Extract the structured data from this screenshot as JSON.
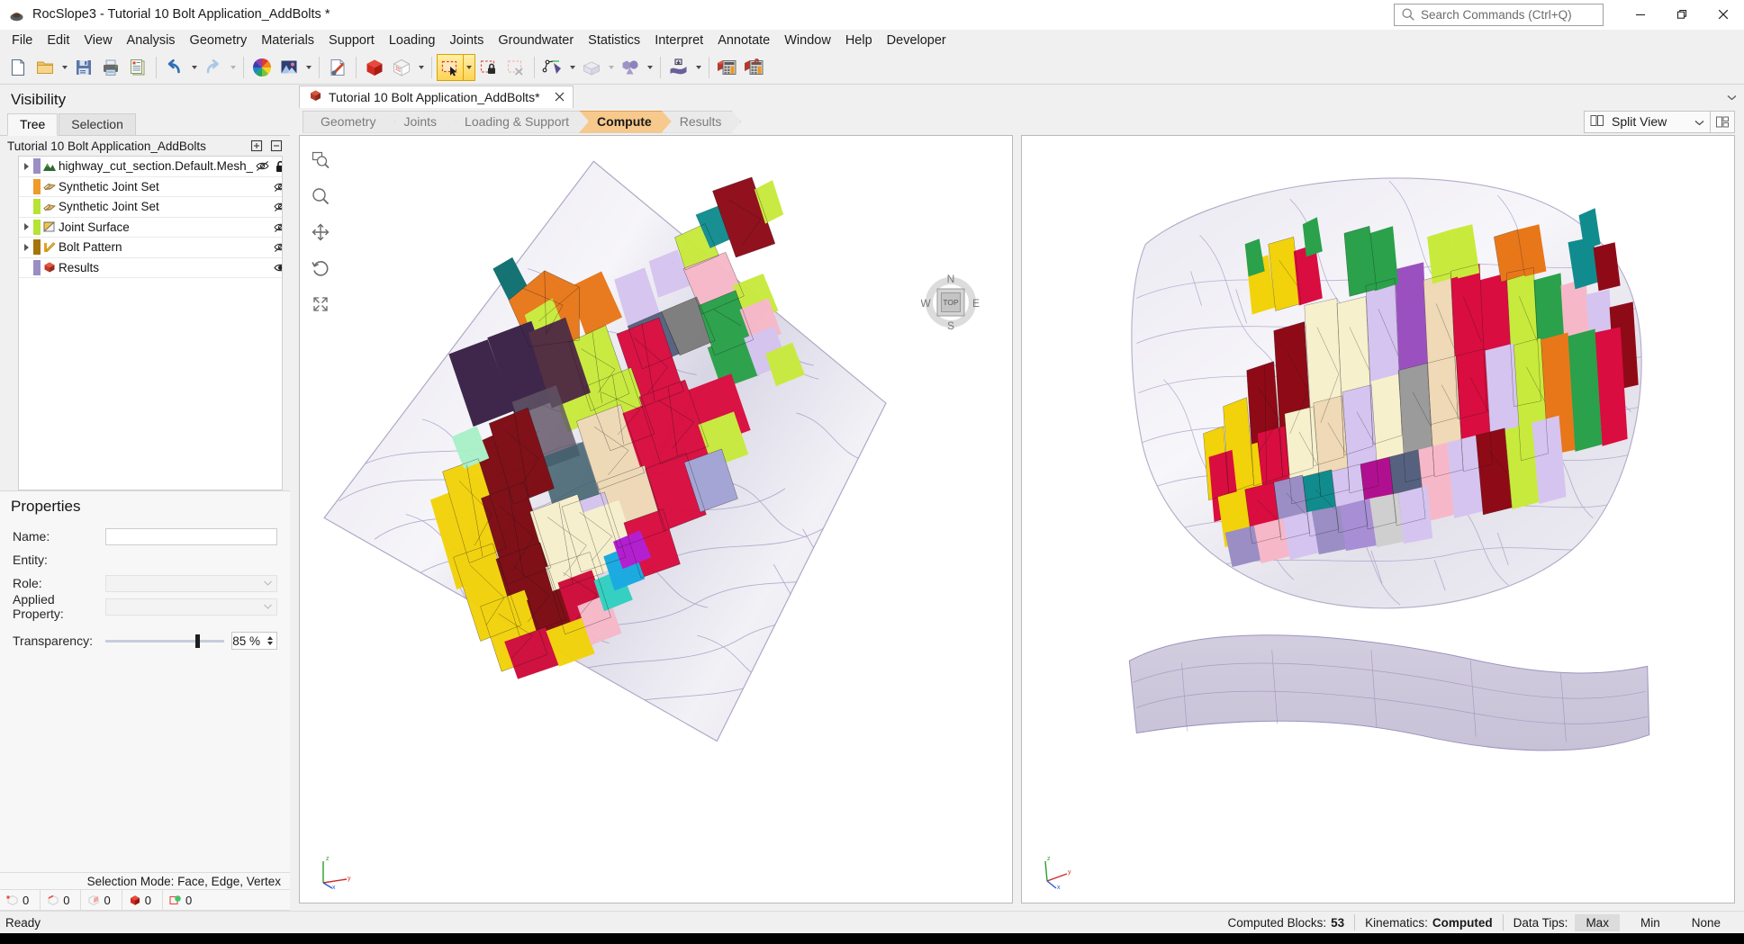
{
  "window": {
    "title": "RocSlope3 - Tutorial 10 Bolt Application_AddBolts *",
    "app_icon": "rocslope-icon",
    "minimize_label": "Minimize",
    "restore_label": "Restore",
    "close_label": "Close"
  },
  "search": {
    "placeholder": "Search Commands (Ctrl+Q)",
    "icon": "search-icon"
  },
  "menu": {
    "items": [
      "File",
      "Edit",
      "View",
      "Analysis",
      "Geometry",
      "Materials",
      "Support",
      "Loading",
      "Joints",
      "Groundwater",
      "Statistics",
      "Interpret",
      "Annotate",
      "Window",
      "Help",
      "Developer"
    ]
  },
  "toolbar": {
    "groups": [
      {
        "buttons": [
          {
            "name": "new-file-icon",
            "tip": "New"
          },
          {
            "name": "open-folder-icon",
            "tip": "Open",
            "dropdown": true
          },
          {
            "name": "save-icon",
            "tip": "Save"
          },
          {
            "name": "print-icon",
            "tip": "Print"
          },
          {
            "name": "report-icon",
            "tip": "Report"
          }
        ]
      },
      {
        "buttons": [
          {
            "name": "undo-icon",
            "tip": "Undo",
            "dropdown": true
          },
          {
            "name": "redo-icon",
            "tip": "Redo",
            "dropdown": true,
            "disabled": true
          }
        ]
      },
      {
        "buttons": [
          {
            "name": "color-wheel-icon",
            "tip": "Display Options"
          },
          {
            "name": "image-icon",
            "tip": "Image",
            "dropdown": true
          }
        ]
      },
      {
        "buttons": [
          {
            "name": "project-settings-icon",
            "tip": "Project Settings"
          }
        ]
      },
      {
        "buttons": [
          {
            "name": "solid-cube-icon",
            "tip": "Show Solids"
          },
          {
            "name": "wireframe-cube-icon",
            "tip": "Show Mesh",
            "dropdown": true
          }
        ]
      },
      {
        "buttons": [
          {
            "name": "select-rectangle-icon",
            "tip": "Select",
            "active": true,
            "dropdown": true
          },
          {
            "name": "lock-selection-icon",
            "tip": "Lock Selection"
          },
          {
            "name": "clear-selection-icon",
            "tip": "Clear Selection",
            "disabled": true
          }
        ]
      },
      {
        "buttons": [
          {
            "name": "polyline-pen-icon",
            "tip": "Add Polyline",
            "dropdown": true
          },
          {
            "name": "box-geometry-icon",
            "tip": "Add Box",
            "dropdown": true
          },
          {
            "name": "boolean-shapes-icon",
            "tip": "Boolean",
            "dropdown": true
          }
        ]
      },
      {
        "buttons": [
          {
            "name": "surface-icon",
            "tip": "Import Surface",
            "dropdown": true
          }
        ]
      },
      {
        "buttons": [
          {
            "name": "compute-icon",
            "tip": "Compute"
          },
          {
            "name": "interpret-icon",
            "tip": "Interpret"
          }
        ]
      }
    ]
  },
  "visibility": {
    "title": "Visibility",
    "tabs": [
      {
        "label": "Tree",
        "selected": true
      },
      {
        "label": "Selection",
        "selected": false
      }
    ],
    "root_label": "Tutorial 10 Bolt Application_AddBolts",
    "expand_all_icon": "expand-all-icon",
    "collapse_all_icon": "collapse-all-icon",
    "tree": [
      {
        "label": "highway_cut_section.Default.Mesh_",
        "icon": "terrain-mesh-icon",
        "swatch": "#9b8ec4",
        "expandable": true,
        "visible": false,
        "locked": true,
        "visibility_icon": "eye-hidden-icon",
        "lock_icon": "lock-icon",
        "delete_icon": "trash-icon"
      },
      {
        "label": "Synthetic Joint Set",
        "icon": "joint-set-icon",
        "swatch": "#f09a28",
        "expandable": false,
        "visible": false,
        "locked": false,
        "visibility_icon": "eye-hidden-icon",
        "delete_icon": "trash-icon"
      },
      {
        "label": "Synthetic Joint Set",
        "icon": "joint-set-icon",
        "swatch": "#b6e335",
        "expandable": false,
        "visible": false,
        "locked": false,
        "visibility_icon": "eye-hidden-icon",
        "delete_icon": "trash-icon"
      },
      {
        "label": "Joint Surface",
        "icon": "joint-surface-icon",
        "swatch": "#b6e335",
        "expandable": true,
        "visible": false,
        "locked": false,
        "visibility_icon": "eye-hidden-icon",
        "delete_icon": "trash-icon"
      },
      {
        "label": "Bolt Pattern",
        "icon": "bolt-pattern-icon",
        "swatch": "#a5750a",
        "expandable": true,
        "visible": false,
        "locked": false,
        "visibility_icon": "eye-hidden-icon",
        "delete_icon": "trash-icon"
      },
      {
        "label": "Results",
        "icon": "results-icon",
        "swatch": "#9b8ec4",
        "expandable": false,
        "visible": true,
        "locked": false,
        "visibility_icon": "eye-visible-icon",
        "delete_icon": "trash-icon"
      }
    ]
  },
  "properties": {
    "title": "Properties",
    "fields": [
      {
        "label": "Name:",
        "value": "",
        "kind": "text"
      },
      {
        "label": "Entity:",
        "value": "",
        "kind": "static"
      },
      {
        "label": "Role:",
        "value": "",
        "kind": "combo"
      },
      {
        "label": "Applied Property:",
        "value": "",
        "kind": "combo"
      }
    ],
    "transparency": {
      "label": "Transparency:",
      "value": "85 %",
      "percent": 85
    }
  },
  "selection_status": {
    "mode_label": "Selection Mode:",
    "mode_value": "Face, Edge, Vertex",
    "counters": [
      {
        "icon": "vertex-count-icon",
        "value": "0"
      },
      {
        "icon": "edge-count-icon",
        "value": "0"
      },
      {
        "icon": "face-count-icon",
        "value": "0"
      },
      {
        "icon": "solid-count-icon",
        "value": "0"
      },
      {
        "icon": "block-count-icon",
        "value": "0"
      }
    ]
  },
  "document": {
    "tab_label": "Tutorial 10 Bolt Application_AddBolts*",
    "tab_icon": "document-icon",
    "close_icon": "close-icon",
    "overflow_icon": "chevron-down-icon"
  },
  "workflow": {
    "steps": [
      {
        "label": "Geometry",
        "selected": false
      },
      {
        "label": "Joints",
        "selected": false
      },
      {
        "label": "Loading & Support",
        "selected": false
      },
      {
        "label": "Compute",
        "selected": true
      },
      {
        "label": "Results",
        "selected": false
      }
    ]
  },
  "view_controls": {
    "split_view_label": "Split View",
    "split_view_icon": "split-view-icon",
    "dropdown_icon": "chevron-down-icon",
    "layout_icon": "view-layout-icon"
  },
  "viewport_tools": [
    {
      "name": "zoom-window-icon",
      "tip": "Zoom Window"
    },
    {
      "name": "zoom-icon",
      "tip": "Zoom"
    },
    {
      "name": "pan-icon",
      "tip": "Pan"
    },
    {
      "name": "rotate-icon",
      "tip": "Rotate"
    },
    {
      "name": "zoom-all-icon",
      "tip": "Zoom All"
    }
  ],
  "compass": {
    "north": "N",
    "south": "S",
    "east": "E",
    "west": "W",
    "face": "TOP"
  },
  "axis_gizmo": {
    "x": "x",
    "y": "y",
    "z": "z"
  },
  "statusbar": {
    "ready": "Ready",
    "computed_blocks_label": "Computed Blocks:",
    "computed_blocks_value": "53",
    "kinematics_label": "Kinematics:",
    "kinematics_value": "Computed",
    "data_tips_label": "Data Tips:",
    "data_tips_options": [
      {
        "label": "Max",
        "selected": true
      },
      {
        "label": "Min",
        "selected": false
      },
      {
        "label": "None",
        "selected": false
      }
    ]
  },
  "colors": {
    "accent": "#f8c98c",
    "selection_highlight": "#ffd453",
    "panel_bg": "#f0f0f0",
    "joint_purple": "#9b8ec4"
  }
}
